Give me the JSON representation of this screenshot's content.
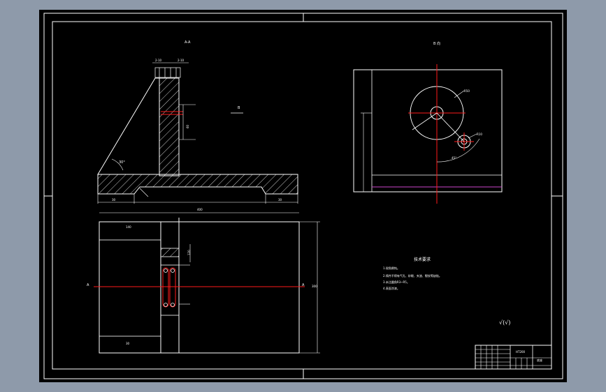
{
  "viewport": {
    "background": "#8e9aaa",
    "sheet_color": "#000000"
  },
  "colors": {
    "line": "#ffffff",
    "center": "#ff1a1a",
    "hatch": "#ffffff",
    "accent": "#cc44cc"
  },
  "labels": {
    "section_aa": "A-A",
    "view_b": "B",
    "view_b_small": "B 向",
    "angle": "30°",
    "dim_top_left": "2-10",
    "dim_top_right": "2-10",
    "dim_bottom_left": "30",
    "dim_bottom_right": "30",
    "dim_400": "400",
    "dim_140": "140",
    "dim_120": "120",
    "dim_30": "30",
    "dim_60": "60",
    "mark_a_left": "A",
    "mark_a_right": "A",
    "radius_big": "R50",
    "radius_small": "R10",
    "angle_45": "45°",
    "dim_300": "300"
  },
  "tech": {
    "title": "技术要求",
    "lines": [
      "1.锐角倒钝。",
      "2.铸件不得有气孔、砂眼、夹渣、裂纹等缺陷。",
      "3.未注圆角R3~R5。",
      "4.表面涂漆。"
    ]
  },
  "roughness": "√(√)",
  "title_block": {
    "name": "底座",
    "part": "HT200"
  }
}
